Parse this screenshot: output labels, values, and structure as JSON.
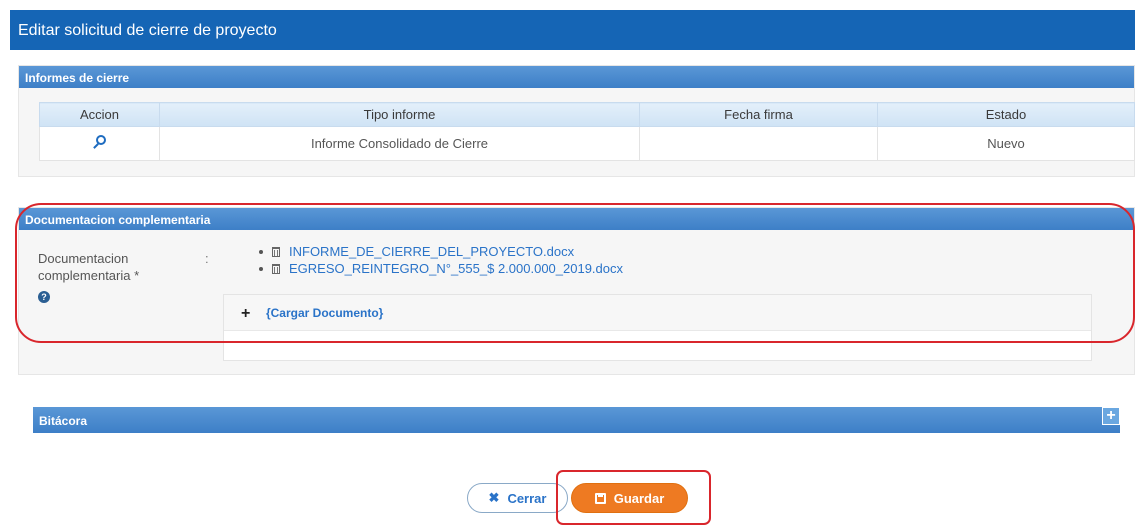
{
  "window": {
    "title": "Editar solicitud de cierre de proyecto"
  },
  "informes": {
    "header": "Informes de cierre",
    "columns": [
      "Accion",
      "Tipo informe",
      "Fecha firma",
      "Estado"
    ],
    "rows": [
      {
        "action_icon": "search-icon",
        "tipo": "Informe Consolidado de Cierre",
        "fecha": "",
        "estado": "Nuevo"
      }
    ]
  },
  "documentacion": {
    "header": "Documentacion complementaria",
    "label": "Documentacion complementaria *",
    "colon": ":",
    "help_icon": "question-circle-icon",
    "files": [
      {
        "name": "INFORME_DE_CIERRE_DEL_PROYECTO.docx",
        "icon": "trash-icon"
      },
      {
        "name": "EGRESO_REINTEGRO_N°_555_$ 2.000.000_2019.docx",
        "icon": "trash-icon"
      }
    ],
    "upload_label": "{Cargar Documento}"
  },
  "bitacora": {
    "header": "Bitácora",
    "expand_symbol": "+"
  },
  "footer": {
    "close_label": "Cerrar",
    "close_icon": "x-icon",
    "save_label": "Guardar",
    "save_icon": "floppy-disk-icon"
  },
  "colors": {
    "header_blue": "#1565b5",
    "panel_blue": "#3d7fc7",
    "save_orange": "#ee7a22",
    "highlight_red": "#d9262c"
  }
}
